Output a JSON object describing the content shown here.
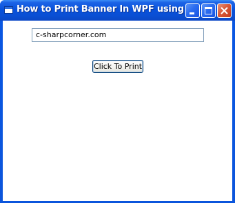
{
  "window": {
    "title": "How to Print Banner In WPF using F#",
    "title_icon": "window-app-icon",
    "controls": {
      "minimize_icon": "minimize-icon",
      "maximize_icon": "maximize-icon",
      "close_icon": "close-icon"
    }
  },
  "content": {
    "textbox_value": "c-sharpcorner.com",
    "print_button_label": "Click To Print"
  },
  "colors": {
    "titlebar": "#0a4fd4",
    "close_button": "#d8593a",
    "textbox_border": "#7f9db9",
    "button_border": "#003c74"
  }
}
